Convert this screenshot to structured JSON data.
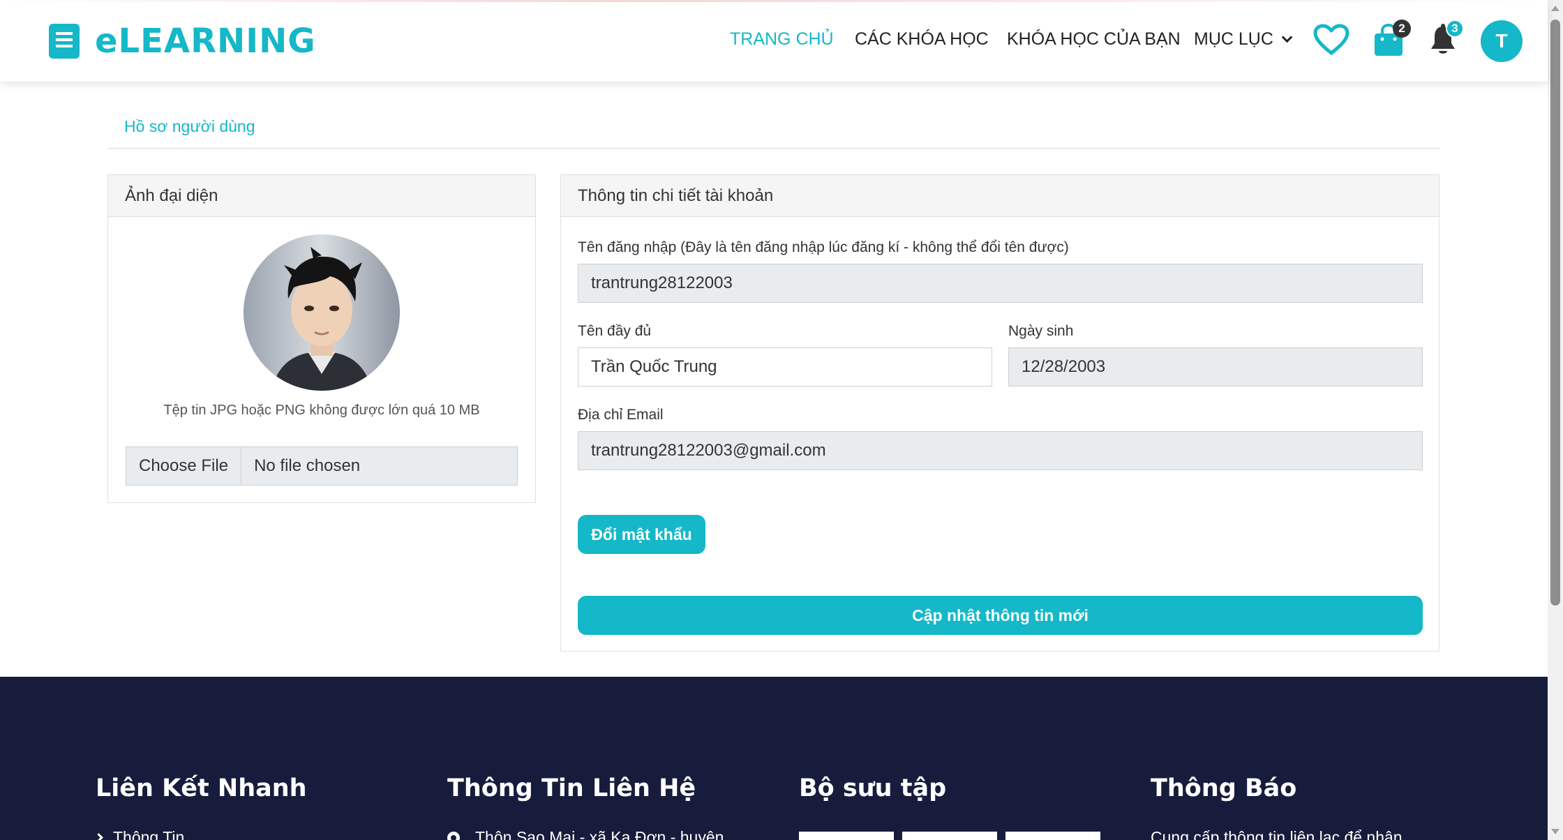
{
  "brand": {
    "name": "eLEARNING",
    "color": "#14b8c8"
  },
  "nav": {
    "home": "TRANG CHỦ",
    "courses": "CÁC KHÓA HỌC",
    "my_courses": "KHÓA HỌC CỦA BẠN",
    "menu": "MỤC LỤC"
  },
  "header_icons": {
    "wishlist_icon": "heart-icon",
    "cart_icon": "shopping-bag-icon",
    "cart_count": "2",
    "notifications_icon": "bell-icon",
    "notification_count": "3",
    "user_initial": "T"
  },
  "breadcrumb": "Hồ sơ người dùng",
  "avatar_card": {
    "title": "Ảnh đại diện",
    "note": "Tệp tin JPG hoặc PNG không được lớn quá 10 MB",
    "choose_file": "Choose File",
    "no_file": "No file chosen"
  },
  "account_card": {
    "title": "Thông tin chi tiết tài khoản",
    "username_label": "Tên đăng nhập (Đây là tên đăng nhập lúc đăng kí - không thể đổi tên được)",
    "username": "trantrung28122003",
    "fullname_label": "Tên đầy đủ",
    "fullname": "Trần Quốc Trung",
    "birthday_label": "Ngày sinh",
    "birthday": "12/28/2003",
    "email_label": "Địa chỉ Email",
    "email": "trantrung28122003@gmail.com",
    "change_password": "Đổi mật khẩu",
    "update": "Cập nhật thông tin mới"
  },
  "footer": {
    "quick_links_title": "Liên Kết Nhanh",
    "quick_link_1": "Thông Tin",
    "contact_title": "Thông Tin Liên Hệ",
    "address": "Thôn Sao Mai - xã Ka Đơn - huyện",
    "gallery_title": "Bộ sưu tập",
    "notice_title": "Thông Báo",
    "notice_text": "Cung cấp thông tin liên lạc để nhận"
  }
}
